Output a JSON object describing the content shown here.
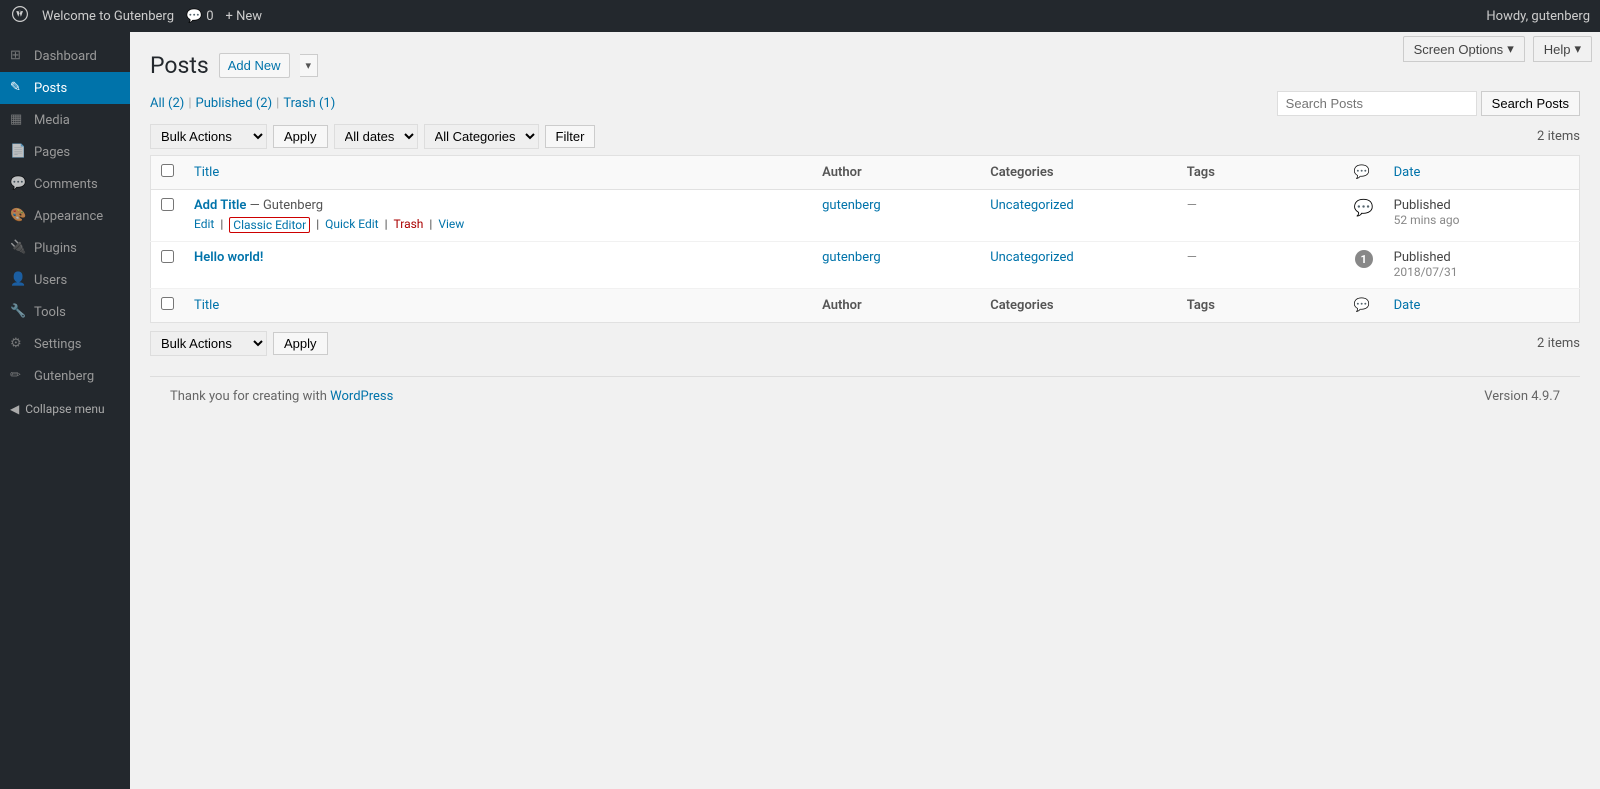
{
  "adminbar": {
    "site_name": "Welcome to Gutenberg",
    "comments_count": "0",
    "new_label": "+ New",
    "howdy": "Howdy, gutenberg",
    "wp_logo_alt": "WordPress"
  },
  "top_right": {
    "screen_options": "Screen Options",
    "help": "Help"
  },
  "sidebar": {
    "items": [
      {
        "label": "Dashboard",
        "icon": "⊞"
      },
      {
        "label": "Posts",
        "icon": "✎",
        "current": true
      },
      {
        "label": "Media",
        "icon": "🖼"
      },
      {
        "label": "Pages",
        "icon": "📄"
      },
      {
        "label": "Comments",
        "icon": "💬"
      },
      {
        "label": "Appearance",
        "icon": "🎨"
      },
      {
        "label": "Plugins",
        "icon": "🔌"
      },
      {
        "label": "Users",
        "icon": "👤"
      },
      {
        "label": "Tools",
        "icon": "🔧"
      },
      {
        "label": "Settings",
        "icon": "⚙"
      },
      {
        "label": "Gutenberg",
        "icon": "✏"
      }
    ],
    "collapse_label": "Collapse menu"
  },
  "page": {
    "title": "Posts",
    "add_new_label": "Add New"
  },
  "filter_links": {
    "all_label": "All",
    "all_count": "(2)",
    "published_label": "Published",
    "published_count": "(2)",
    "trash_label": "Trash",
    "trash_count": "(1)"
  },
  "search": {
    "placeholder": "Search Posts",
    "button_label": "Search Posts"
  },
  "bulk_bar_top": {
    "bulk_actions_label": "Bulk Actions",
    "apply_label": "Apply",
    "all_dates_label": "All dates",
    "all_categories_label": "All Categories",
    "filter_label": "Filter",
    "items_count": "2 items"
  },
  "bulk_bar_bottom": {
    "bulk_actions_label": "Bulk Actions",
    "apply_label": "Apply",
    "items_count": "2 items"
  },
  "table": {
    "columns": {
      "title": "Title",
      "author": "Author",
      "categories": "Categories",
      "tags": "Tags",
      "comments": "💬",
      "date": "Date"
    },
    "rows": [
      {
        "title": "Add Title",
        "title_separator": "— Gutenberg",
        "author": "gutenberg",
        "categories": "Uncategorized",
        "tags": "—",
        "comments": "",
        "comments_count": "",
        "date_status": "Published",
        "date_value": "52 mins ago",
        "actions": {
          "edit": "Edit",
          "classic_editor": "Classic Editor",
          "quick_edit": "Quick Edit",
          "trash": "Trash",
          "view": "View"
        }
      },
      {
        "title": "Hello world!",
        "title_separator": "",
        "author": "gutenberg",
        "categories": "Uncategorized",
        "tags": "—",
        "comments": "1",
        "comments_count": "1",
        "date_status": "Published",
        "date_value": "2018/07/31",
        "actions": {}
      }
    ]
  },
  "footer": {
    "thank_you": "Thank you for creating with ",
    "wordpress_link": "WordPress",
    "version": "Version 4.9.7"
  }
}
